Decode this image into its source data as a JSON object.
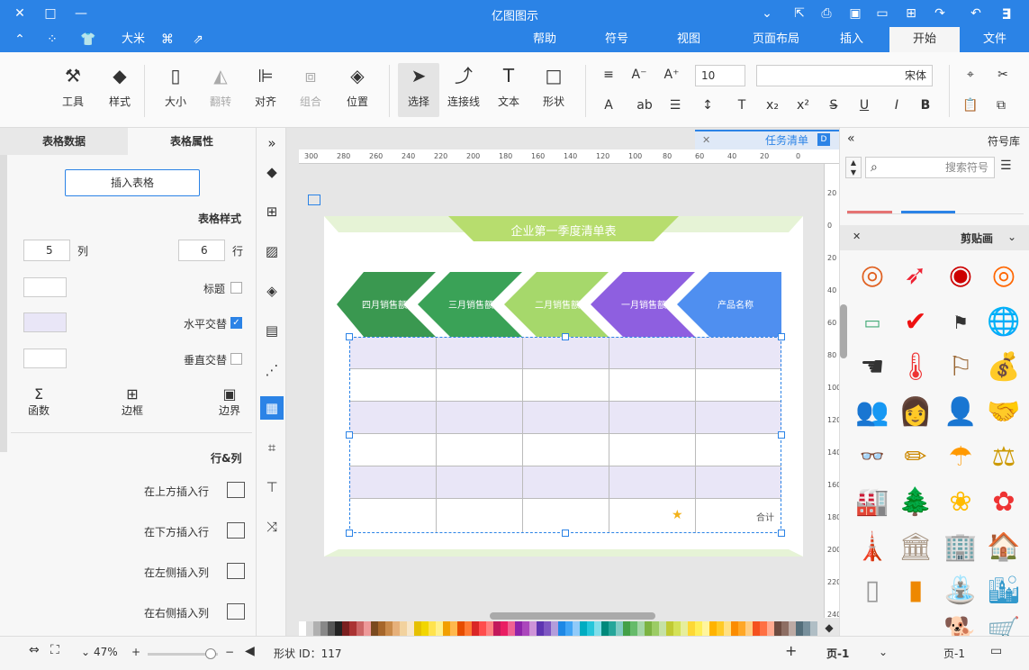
{
  "title_bar": {
    "app_title": "亿图图示"
  },
  "menu": {
    "tabs": [
      "文件",
      "开始",
      "插入",
      "页面布局",
      "视图",
      "符号",
      "帮助"
    ],
    "active": "开始",
    "user_label": "大米"
  },
  "ribbon": {
    "font_name": "宋体",
    "font_size": "10",
    "tools": [
      "形状",
      "文本",
      "连接线",
      "选择",
      "位置",
      "组合",
      "对齐",
      "翻转",
      "大小",
      "样式",
      "工具"
    ]
  },
  "left_panel": {
    "tabs": [
      "表格属性",
      "表格数据"
    ],
    "insert_table_button": "插入表格",
    "table_style_title": "表格样式",
    "rows_label": "行",
    "rows_value": "6",
    "cols_label": "列",
    "cols_value": "5",
    "options": [
      {
        "label": "标题",
        "checked": false
      },
      {
        "label": "水平交替",
        "checked": true
      },
      {
        "label": "垂直交替",
        "checked": false
      }
    ],
    "alt_color": "#e9e6f7",
    "border_buttons": [
      "边界",
      "边框",
      "函数"
    ],
    "rows_cols_title": "行&列",
    "row_actions": [
      "在上方插入行",
      "在下方插入行",
      "在左侧插入列",
      "在右侧插入列"
    ]
  },
  "document": {
    "tab_label": "任务清单",
    "ruler_h": [
      "300",
      "280",
      "260",
      "240",
      "220",
      "200",
      "180",
      "160",
      "140",
      "120",
      "100",
      "80",
      "60",
      "40",
      "20",
      "0"
    ],
    "ruler_v": [
      "20",
      "0",
      "20",
      "40",
      "60",
      "80",
      "100",
      "120",
      "140",
      "160",
      "180",
      "200",
      "220",
      "240"
    ],
    "banner_title": "企业第一季度清单表",
    "headers": [
      "产品名称",
      "一月销售额",
      "二月销售额",
      "三月销售额",
      "四月销售额"
    ],
    "header_colors": [
      "#4f8ff0",
      "#8e5fe0",
      "#a6d86b",
      "#3aa257",
      "#3a9850"
    ],
    "footer_label": "合计"
  },
  "right_panel": {
    "title": "符号库",
    "search_placeholder": "搜索符号",
    "category": "剪贴画",
    "symbols": [
      "target-icon",
      "dart-icon",
      "bullseye-icon",
      "darts-icon",
      "globe-icon",
      "flag-icon",
      "checkmark-icon",
      "money-icon",
      "bag-icon",
      "signpost-icon",
      "thermometer-icon",
      "pointing-hand-icon",
      "handshake-icon",
      "businessman-icon",
      "woman-icon",
      "meeting-icon",
      "scales-icon",
      "umbrella-icon",
      "pencil-icon",
      "glasses-icon",
      "flower-icon",
      "sunflower-icon",
      "tree-icon",
      "factory-icon",
      "building-icon",
      "skyscraper-icon",
      "tower-icon",
      "temple-icon",
      "barrel-icon",
      "paper-icon",
      "buildings-icon",
      "fountain-icon",
      "dog-icon",
      "cart-icon"
    ]
  },
  "status_bar": {
    "page_selector": "页-1",
    "page_tab": "页-1",
    "add_page": "+",
    "shape_id": "形状 ID：117",
    "zoom": "47%"
  }
}
